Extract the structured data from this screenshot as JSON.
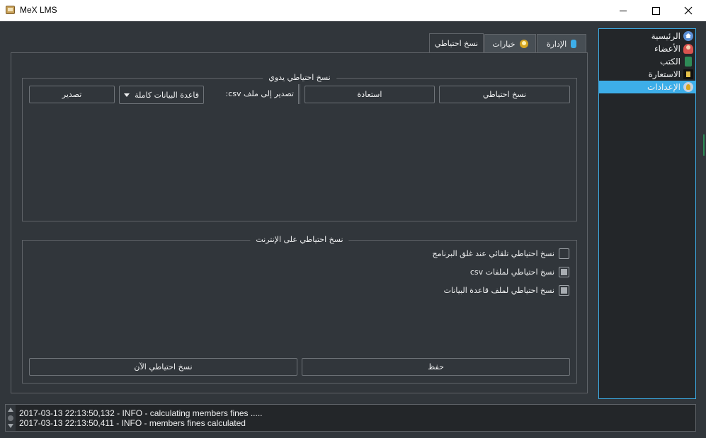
{
  "window": {
    "title": "MeX LMS"
  },
  "nav": {
    "items": [
      {
        "label": "الرئيسية",
        "icon": "home-icon"
      },
      {
        "label": "الأعضاء",
        "icon": "members-icon"
      },
      {
        "label": "الكتب",
        "icon": "books-icon"
      },
      {
        "label": "الاستعارة",
        "icon": "borrow-icon"
      },
      {
        "label": "الإعدادات",
        "icon": "settings-icon",
        "active": true
      }
    ]
  },
  "tabs": [
    {
      "label": "نسخ احتياطي",
      "active": true
    },
    {
      "label": "خيارات",
      "icon": "bulb-icon"
    },
    {
      "label": "الإدارة",
      "icon": "admin-icon"
    }
  ],
  "manual_backup": {
    "title": "نسخ احتياطي يدوي",
    "backup_label": "نسخ احتياطي",
    "restore_label": "استعادة",
    "export_csv_label": "تصدير إلى ملف csv:",
    "select_value": "قاعدة البيانات كاملة",
    "export_label": "تصدير"
  },
  "online_backup": {
    "title": "نسخ احتياطي على الإنترنت",
    "options": [
      {
        "label": "نسخ احتياطي تلقائي عند غلق البرنامج",
        "state": "unchecked"
      },
      {
        "label": "نسخ احتياطي لملفات  csv",
        "state": "partial"
      },
      {
        "label": "نسخ احتياطي لملف قاعدة البيانات",
        "state": "partial"
      }
    ],
    "save_label": "حفظ",
    "backup_now_label": "نسخ احتياطي الآن"
  },
  "log": {
    "lines": [
      "2017-03-13 22:13:50,132 - INFO - calculating members fines .....",
      "2017-03-13 22:13:50,411 - INFO - members fines calculated"
    ]
  },
  "colors": {
    "background": "#31363b",
    "accent": "#3daee9",
    "panel_dark": "#232629",
    "border": "#5f6368"
  }
}
